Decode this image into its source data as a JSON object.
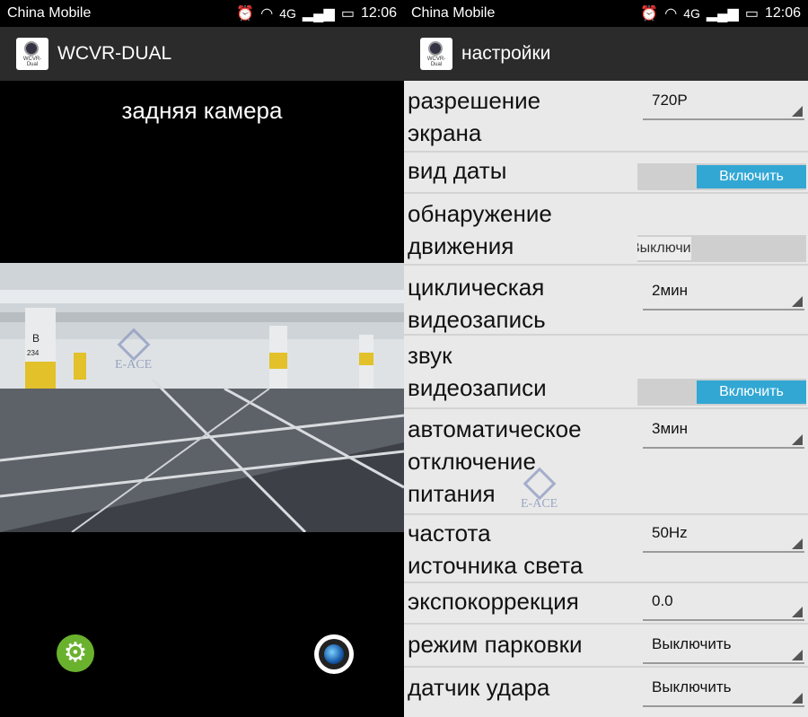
{
  "left_screen": {
    "status": {
      "carrier": "China Mobile",
      "network": "4G",
      "time": "12:06"
    },
    "app_title": "WCVR-DUAL",
    "logo_caption": "WCVR-Dual",
    "camera_label": "задняя камера",
    "watermark": "E-ACE",
    "buttons": {
      "settings_icon": "gear-icon",
      "capture_icon": "camera-lens-icon"
    }
  },
  "right_screen": {
    "status": {
      "carrier": "China Mobile",
      "network": "4G",
      "time": "12:06"
    },
    "app_title": "настройки",
    "logo_caption": "WCVR-Dual",
    "watermark": "E-ACE",
    "settings": [
      {
        "label_lines": [
          "разрешение",
          "экрана"
        ],
        "control": "spinner",
        "value": "720P"
      },
      {
        "label_lines": [
          "вид даты"
        ],
        "control": "toggle",
        "value": "Включить"
      },
      {
        "label_lines": [
          "обнаружение",
          "движения"
        ],
        "control": "toggle-off",
        "value": "Выключить"
      },
      {
        "label_lines": [
          "циклическая",
          "видеозапись"
        ],
        "control": "spinner",
        "value": "2мин"
      },
      {
        "label_lines": [
          "звук",
          "видеозаписи"
        ],
        "control": "toggle",
        "value": "Включить"
      },
      {
        "label_lines": [
          "автоматическое",
          "отключение",
          "питания"
        ],
        "control": "spinner",
        "value": "3мин"
      },
      {
        "label_lines": [
          "частота",
          "источника света"
        ],
        "control": "spinner",
        "value": "50Hz"
      },
      {
        "label_lines": [
          "экспокоррекция"
        ],
        "control": "spinner",
        "value": "0.0"
      },
      {
        "label_lines": [
          "режим парковки"
        ],
        "control": "spinner",
        "value": "Выключить"
      },
      {
        "label_lines": [
          "датчик удара"
        ],
        "control": "spinner",
        "value": "Выключить"
      }
    ]
  },
  "colors": {
    "toggle_on": "#32a7d4",
    "settings_button": "#6ab22e",
    "appbar": "#2b2b2b"
  }
}
